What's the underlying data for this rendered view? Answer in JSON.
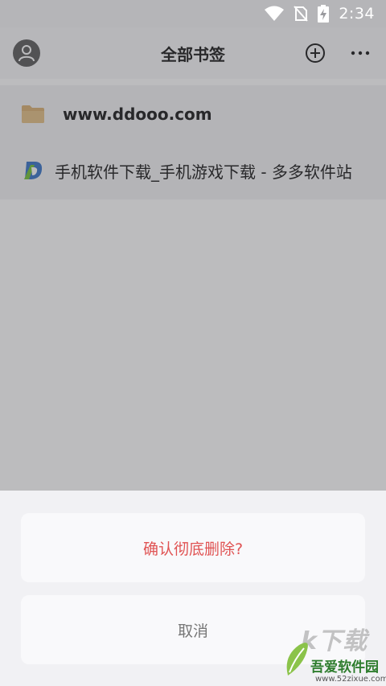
{
  "status_bar": {
    "time": "2:34"
  },
  "header": {
    "title": "全部书签"
  },
  "list": {
    "items": [
      {
        "label": "www.ddooo.com",
        "type": "folder",
        "icon": "folder-icon"
      },
      {
        "label": "手机软件下载_手机游戏下载 - 多多软件站",
        "type": "bookmark",
        "icon": "site-favicon"
      }
    ]
  },
  "sheet": {
    "confirm_label": "确认彻底删除?",
    "cancel_label": "取消"
  },
  "watermark": {
    "big": "k下载",
    "name": "吾爱软件园",
    "url": "www.52zixue.com"
  },
  "colors": {
    "danger": "#e05353",
    "folder": "#d9ad6d",
    "favicon_green": "#6cbf2e",
    "favicon_blue": "#2f6ec6"
  }
}
